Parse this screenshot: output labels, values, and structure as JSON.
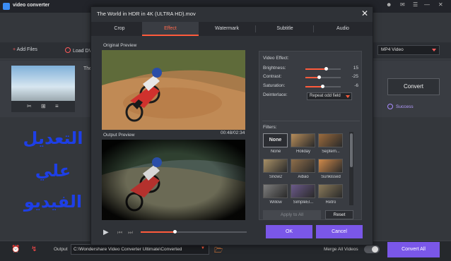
{
  "app": {
    "title": "video converter"
  },
  "toolbar": {
    "add_files": "Add Files",
    "load_dvd": "Load DV",
    "format": "MP4 Video"
  },
  "file": {
    "name_prefix": "The",
    "convert": "Convert",
    "status": "Success"
  },
  "overlay_text": [
    "التعديل",
    "علي",
    "الفيديو"
  ],
  "bottom": {
    "output_label": "Output",
    "output_path": "C:\\Wondershare Video Converter Ultimate\\Converted",
    "merge_label": "Merge All Videos",
    "convert_all": "Convert All"
  },
  "dialog": {
    "title": "The World in HDR in 4K (ULTRA HD).mov",
    "tabs": [
      "Crop",
      "Effect",
      "Watermark",
      "Subtitle",
      "Audio"
    ],
    "active_tab": "Effect",
    "original_label": "Original Preview",
    "output_label": "Output Preview",
    "timecode": "00:48/02:34",
    "playback_progress": 0.32,
    "effect": {
      "heading": "Video Effect:",
      "adjustments": [
        {
          "label": "Brightness:",
          "value": 15,
          "level": 0.57
        },
        {
          "label": "Contrast:",
          "value": -25,
          "level": 0.38
        },
        {
          "label": "Saturation:",
          "value": -6,
          "level": 0.47
        }
      ],
      "deinterlace_label": "Deinterlace:",
      "deinterlace_value": "Repeat odd field"
    },
    "filters_label": "Filters:",
    "filters": [
      {
        "name": "None",
        "thumb": "None",
        "color": "#2b2d32"
      },
      {
        "name": "Holiday",
        "color": "#b78d5a"
      },
      {
        "name": "Septem...",
        "color": "#9b6a3c"
      },
      {
        "name": "Snow2",
        "color": "#a89066"
      },
      {
        "name": "Aibao",
        "color": "#8f6e4a"
      },
      {
        "name": "Sunkissed",
        "color": "#d08a4a"
      },
      {
        "name": "Willow",
        "color": "#7d7d7d"
      },
      {
        "name": "SimpleEl...",
        "color": "#6b5a8a"
      },
      {
        "name": "Retro",
        "color": "#8a7a5a"
      },
      {
        "name": "",
        "color": "#6a6a6a"
      },
      {
        "name": "",
        "color": "#7a6a5a"
      },
      {
        "name": "",
        "color": "#6a7a8a"
      }
    ],
    "apply_all": "Apply to All",
    "reset": "Reset",
    "ok": "OK",
    "cancel": "Cancel"
  },
  "colors": {
    "accent": "#ff5b3c",
    "primary_button": "#7a57e8",
    "overlay_text": "#1e3fe6"
  }
}
